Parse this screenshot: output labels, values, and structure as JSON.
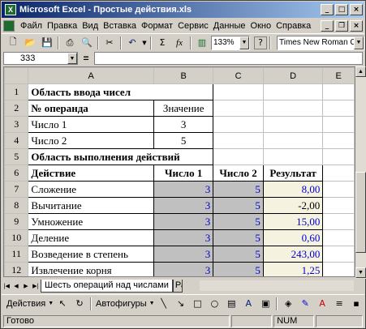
{
  "window": {
    "title": "Microsoft Excel - Простые действия.xls"
  },
  "menu": [
    "Файл",
    "Правка",
    "Вид",
    "Вставка",
    "Формат",
    "Сервис",
    "Данные",
    "Окно",
    "Справка"
  ],
  "toolbar": {
    "zoom": "133%",
    "font": "Times New Roman Cyr",
    "sigma": "Σ",
    "fx": "fx",
    "help": "?"
  },
  "formula_bar": {
    "namebox": "333",
    "equals": "=",
    "value": ""
  },
  "columns": [
    "A",
    "B",
    "C",
    "D",
    "E"
  ],
  "rows": [
    {
      "num": "1",
      "a": "Область ввода чисел",
      "b": "",
      "c": "",
      "d": ""
    },
    {
      "num": "2",
      "a": "№ операнда",
      "b": "Значение",
      "c": "",
      "d": ""
    },
    {
      "num": "3",
      "a": "Число 1",
      "b": "3",
      "c": "",
      "d": ""
    },
    {
      "num": "4",
      "a": "Число 2",
      "b": "5",
      "c": "",
      "d": ""
    },
    {
      "num": "5",
      "a": "Область выполнения действий",
      "b": "",
      "c": "",
      "d": ""
    },
    {
      "num": "6",
      "a": "Действие",
      "b": "Число 1",
      "c": "Число 2",
      "d": "Результат"
    },
    {
      "num": "7",
      "a": "Сложение",
      "b": "3",
      "c": "5",
      "d": "8,00"
    },
    {
      "num": "8",
      "a": "Вычитание",
      "b": "3",
      "c": "5",
      "d": "-2,00"
    },
    {
      "num": "9",
      "a": "Умножение",
      "b": "3",
      "c": "5",
      "d": "15,00"
    },
    {
      "num": "10",
      "a": "Деление",
      "b": "3",
      "c": "5",
      "d": "0,60"
    },
    {
      "num": "11",
      "a": "Возведение в степень",
      "b": "3",
      "c": "5",
      "d": "243,00"
    },
    {
      "num": "12",
      "a": "Извлечение корня",
      "b": "3",
      "c": "5",
      "d": "1,25"
    }
  ],
  "sheet_tabs": {
    "active": "Шесть операций над числами",
    "next": "Ра"
  },
  "drawing": {
    "actions": "Действия",
    "autoshapes": "Автофигуры"
  },
  "status": {
    "ready": "Готово",
    "num": "NUM"
  }
}
